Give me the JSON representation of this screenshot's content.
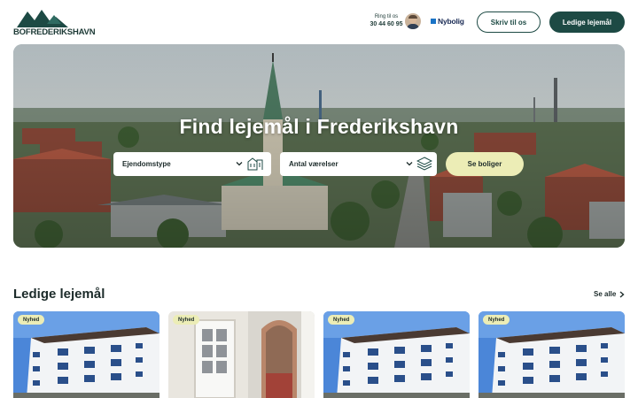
{
  "header": {
    "logo_text": "BOFREDERIKSHAVN",
    "ring_label": "Ring til os",
    "ring_phone": "30 44 60 95",
    "partner_name": "Nybolig",
    "call_button": "Skriv til os",
    "rentals_button": "Ledige lejemål"
  },
  "hero": {
    "title": "Find lejemål i Frederikshavn",
    "property_type_select": "Ejendomstype",
    "rooms_select": "Antal værelser",
    "search_button": "Se boliger"
  },
  "listings": {
    "title": "Ledige lejemål",
    "see_all": "Se alle",
    "cards": [
      {
        "badge": "Nyhed"
      },
      {
        "badge": "Nyhed"
      },
      {
        "badge": "Nyhed"
      },
      {
        "badge": "Nyhed"
      }
    ]
  },
  "colors": {
    "primary": "#1d4a44",
    "accent": "#ecedb6",
    "partner_blue": "#1a73c6"
  },
  "icons": {
    "chevron": "chevron-down-icon",
    "building": "building-icon",
    "layers": "layers-icon",
    "arrow": "chevron-right-icon"
  }
}
